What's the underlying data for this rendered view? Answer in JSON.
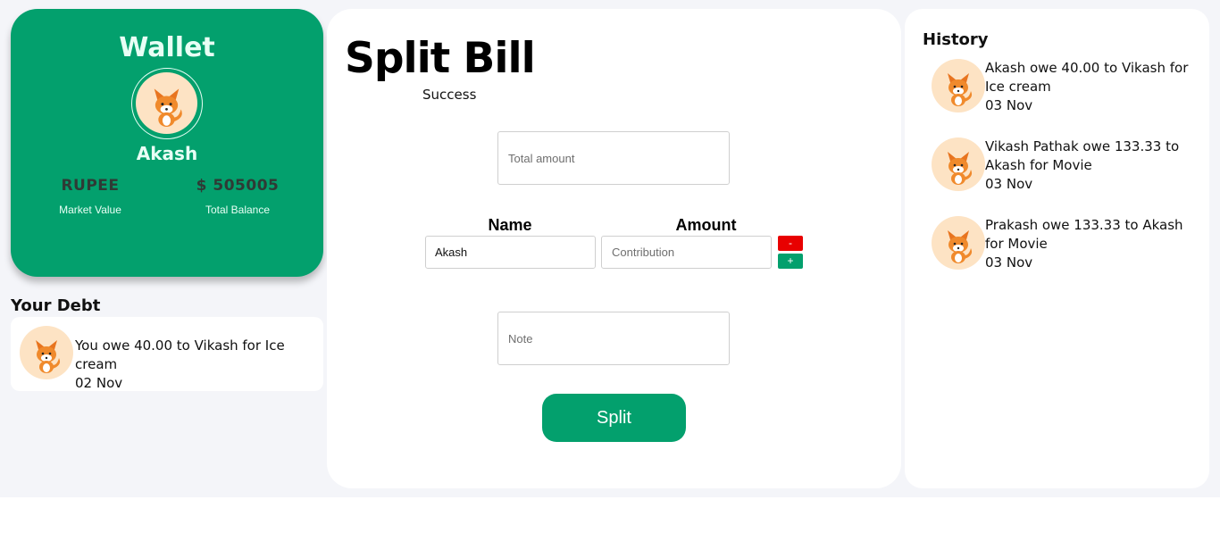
{
  "wallet": {
    "title": "Wallet",
    "user_name": "Akash",
    "market_value": "RUPEE",
    "market_value_label": "Market Value",
    "total_balance": "$ 505005",
    "total_balance_label": "Total Balance",
    "avatar_icon": "fox-avatar-icon"
  },
  "debt": {
    "title": "Your Debt",
    "items": [
      {
        "text": "You owe 40.00 to Vikash for Ice cream",
        "date": "02 Nov"
      }
    ]
  },
  "split": {
    "title": "Split Bill",
    "status": "Success",
    "total_placeholder": "Total amount",
    "total_value": "",
    "name_header": "Name",
    "amount_header": "Amount",
    "name_value": "Akash",
    "amount_placeholder": "Contribution",
    "minus_label": "-",
    "plus_label": "+",
    "note_placeholder": "Note",
    "note_value": "",
    "submit_label": "Split"
  },
  "history": {
    "title": "History",
    "items": [
      {
        "text": "Akash owe 40.00 to Vikash for Ice cream",
        "date": "03 Nov"
      },
      {
        "text": "Vikash Pathak owe 133.33 to Akash for Movie",
        "date": "03 Nov"
      },
      {
        "text": "Prakash owe 133.33 to Akash for Movie",
        "date": "03 Nov"
      }
    ]
  },
  "colors": {
    "accent": "#03a06d",
    "danger": "#e80000",
    "background": "#f4f5f9"
  }
}
